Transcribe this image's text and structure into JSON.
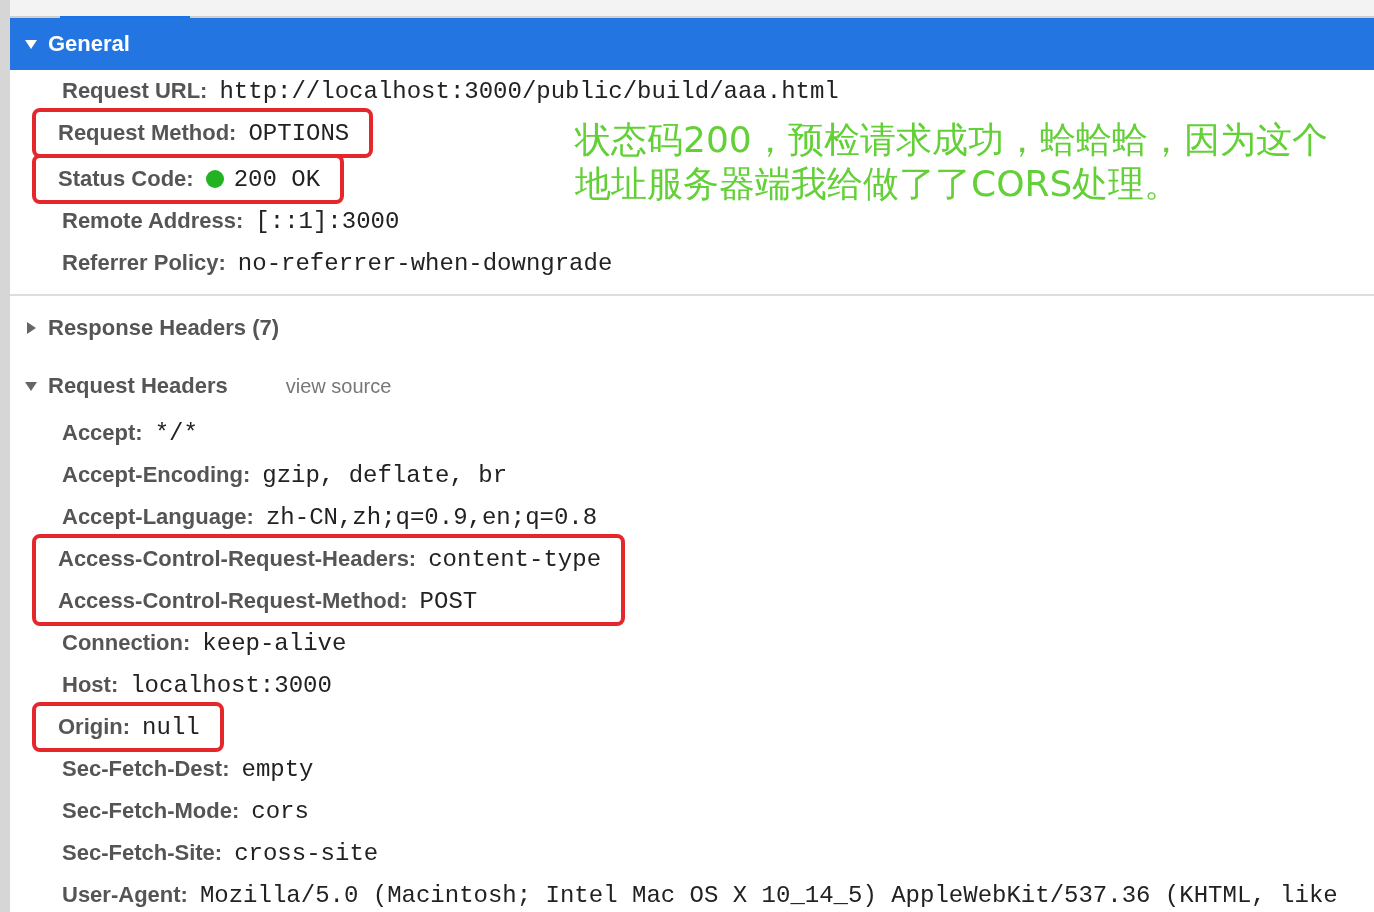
{
  "sections": [
    {
      "title": "General",
      "expanded": true,
      "header_selected": true,
      "rows": [
        {
          "label": "Request URL:",
          "value": "http://localhost:3000/public/build/aaa.html",
          "highlighted": false
        },
        {
          "label": "Request Method:",
          "value": "OPTIONS",
          "highlighted": true
        },
        {
          "label": "Status Code:",
          "value": "200 OK",
          "highlighted": true,
          "status_dot": true
        },
        {
          "label": "Remote Address:",
          "value": "[::1]:3000",
          "highlighted": false
        },
        {
          "label": "Referrer Policy:",
          "value": "no-referrer-when-downgrade",
          "highlighted": false
        }
      ]
    },
    {
      "title": "Response Headers (7)",
      "expanded": false,
      "header_selected": false
    },
    {
      "title": "Request Headers",
      "expanded": true,
      "header_selected": false,
      "link": "view source",
      "rows": [
        {
          "label": "Accept:",
          "value": "*/*",
          "highlighted": false
        },
        {
          "label": "Accept-Encoding:",
          "value": "gzip, deflate, br",
          "highlighted": false
        },
        {
          "label": "Accept-Language:",
          "value": "zh-CN,zh;q=0.9,en;q=0.8",
          "highlighted": false
        },
        {
          "label": "Access-Control-Request-Headers:",
          "value": "content-type",
          "highlighted": true,
          "group_with_next": true
        },
        {
          "label": "Access-Control-Request-Method:",
          "value": "POST",
          "highlighted": true
        },
        {
          "label": "Connection:",
          "value": "keep-alive",
          "highlighted": false
        },
        {
          "label": "Host:",
          "value": "localhost:3000",
          "highlighted": false
        },
        {
          "label": "Origin:",
          "value": "null",
          "highlighted": true
        },
        {
          "label": "Sec-Fetch-Dest:",
          "value": "empty",
          "highlighted": false
        },
        {
          "label": "Sec-Fetch-Mode:",
          "value": "cors",
          "highlighted": false
        },
        {
          "label": "Sec-Fetch-Site:",
          "value": "cross-site",
          "highlighted": false
        },
        {
          "label": "User-Agent:",
          "value": "Mozilla/5.0 (Macintosh; Intel Mac OS X 10_14_5) AppleWebKit/537.36 (KHTML, like",
          "highlighted": false
        }
      ]
    }
  ],
  "annotation": "状态码200，预检请求成功，蛤蛤蛤，因为这个地址服务器端我给做了了CORS处理。"
}
